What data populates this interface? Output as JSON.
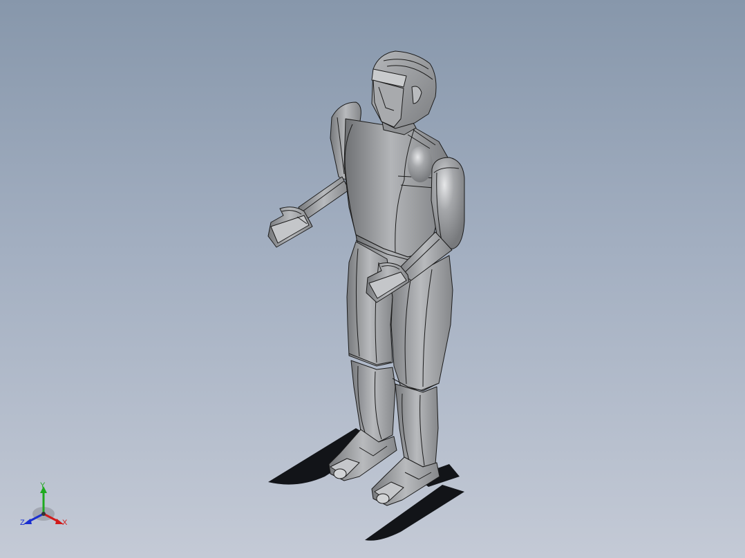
{
  "viewport": {
    "background_top": "#8797ab",
    "background_bottom": "#c4cad6"
  },
  "model": {
    "body_color": "#9a9c9f",
    "edge_color": "#1a1a1a",
    "shadow_color": "#121418"
  },
  "triad": {
    "x_label": "X",
    "y_label": "Y",
    "z_label": "Z",
    "x_color": "#d11a1a",
    "y_color": "#1faa1f",
    "z_color": "#1a2fd0"
  }
}
